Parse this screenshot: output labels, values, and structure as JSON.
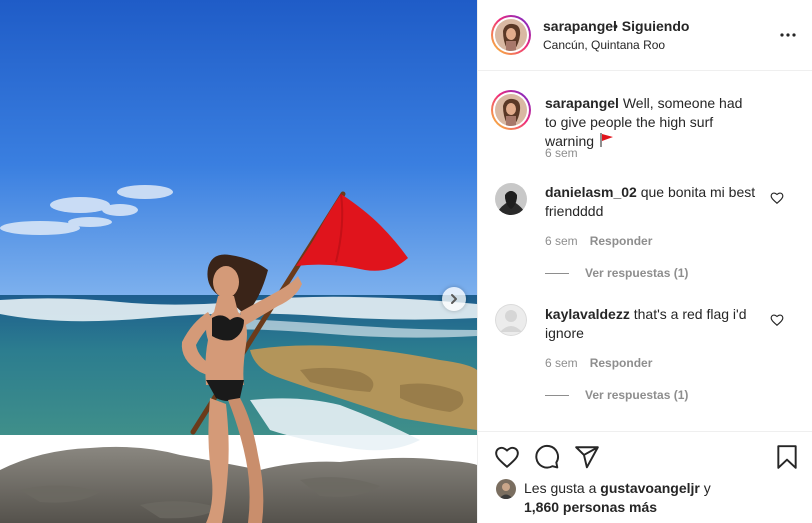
{
  "post": {
    "username": "sarapangel",
    "follow_status": "• Siguiendo",
    "location": "Cancún, Quintana Roo"
  },
  "caption": {
    "username": "sarapangel",
    "text": "Well, someone had to give people the high surf warning",
    "time": "6 sem"
  },
  "comments": [
    {
      "username": "danielasm_02",
      "text": "que bonita mi best friendddd",
      "time": "6 sem",
      "reply_label": "Responder",
      "view_replies": "Ver respuestas (1)"
    },
    {
      "username": "kaylavaldezz",
      "text": "that's a red flag i'd ignore",
      "time": "6 sem",
      "reply_label": "Responder",
      "view_replies": "Ver respuestas (1)"
    }
  ],
  "likes": {
    "prefix": "Les gusta a",
    "liker": "gustavoangeljr",
    "suffix": "y",
    "others": "1,860 personas más"
  },
  "colors": {
    "flag_red": "#e0141c",
    "sky": "#2f6fd6",
    "accent": "#262626",
    "muted": "#8e8e8e"
  },
  "icons": [
    "chevron-right-icon",
    "more-icon",
    "heart-icon",
    "comment-icon",
    "share-icon",
    "bookmark-icon"
  ]
}
